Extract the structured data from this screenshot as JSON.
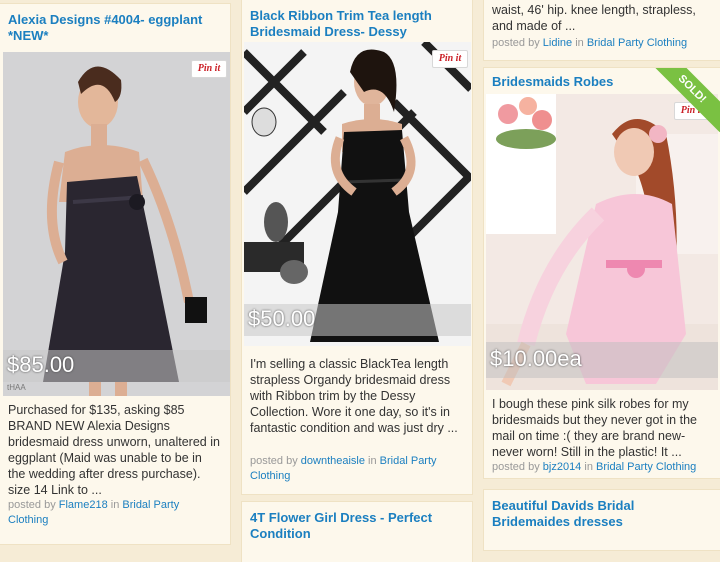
{
  "cards": [
    {
      "title": "Alexia Designs #4004- eggplant *NEW*",
      "price": "$85.00",
      "pin_label": "Pin it",
      "description": "Purchased for $135, asking $85 BRAND NEW Alexia Designs bridesmaid dress unworn, unaltered in eggplant (Maid was unable to be in the wedding after dress purchase). size 14 Link to ...",
      "posted_by_prefix": "posted by",
      "user": "Flame218",
      "in_word": "in",
      "category": "Bridal Party Clothing",
      "watermark": "tHAA"
    },
    {
      "title": "Black Ribbon Trim Tea length Bridesmaid Dress- Dessy",
      "price": "$50.00",
      "pin_label": "Pin it",
      "description": "I'm selling a classic BlackTea length strapless Organdy bridesmaid dress with Ribbon trim by the Dessy Collection. Wore it one day, so it's in fantastic condition and was just dry ...",
      "posted_by_prefix": "posted by",
      "user": "downtheaisle",
      "in_word": "in",
      "category": "Bridal Party Clothing"
    },
    {
      "partial_description": "waist, 46' hip. knee length, strapless, and made of ...",
      "posted_by_prefix": "posted by",
      "user": "Lidine",
      "in_word": "in",
      "category": "Bridal Party Clothing"
    },
    {
      "title": "Bridesmaids Robes",
      "price": "$10.00ea",
      "pin_label": "Pin it",
      "sold_label": "SOLD!",
      "description": "I bough these pink silk robes for my bridesmaids but they never got in the mail on time :( they are brand new- never worn! Still in the plastic! It ...",
      "posted_by_prefix": "posted by",
      "user": "bjz2014",
      "in_word": "in",
      "category": "Bridal Party Clothing"
    },
    {
      "title": "4T Flower Girl Dress - Perfect Condition"
    },
    {
      "title": "Beautiful Davids Bridal Bridemaides dresses"
    }
  ]
}
